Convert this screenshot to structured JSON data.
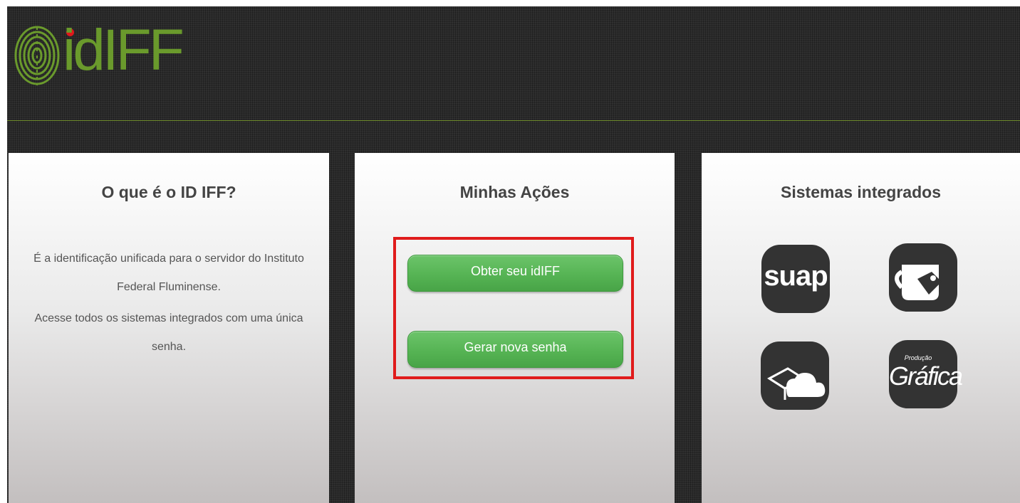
{
  "header": {
    "logo_text": "idIFF",
    "logo_text_color": "#6a9a2c",
    "logo_dot_color": "#e0181b",
    "line_color": "#6d8a2c",
    "logo_icon": "fingerprint-icon"
  },
  "panels": {
    "about": {
      "title": "O que é o ID IFF?",
      "line1": "É a identificação unificada para o servidor do Instituto Federal Fluminense.",
      "line2": "Acesse todos os sistemas integrados com uma única senha."
    },
    "actions": {
      "title": "Minhas Ações",
      "button_obter": "Obter seu idIFF",
      "button_gerar": "Gerar nova senha",
      "highlight_color": "#e01b1b"
    },
    "systems": {
      "title": "Sistemas integrados",
      "items": [
        {
          "name": "suap",
          "label": "suap",
          "icon": "suap-icon"
        },
        {
          "name": "mug",
          "icon": "mug-tag-icon"
        },
        {
          "name": "cloud-box",
          "icon": "cloud-box-icon"
        },
        {
          "name": "grafica",
          "label": "Gráfica",
          "sublabel": "Produção",
          "icon": "grafica-icon"
        }
      ]
    }
  },
  "colors": {
    "button_green": "#56b454",
    "panel_title": "#444444",
    "icon_bg": "#333333"
  }
}
